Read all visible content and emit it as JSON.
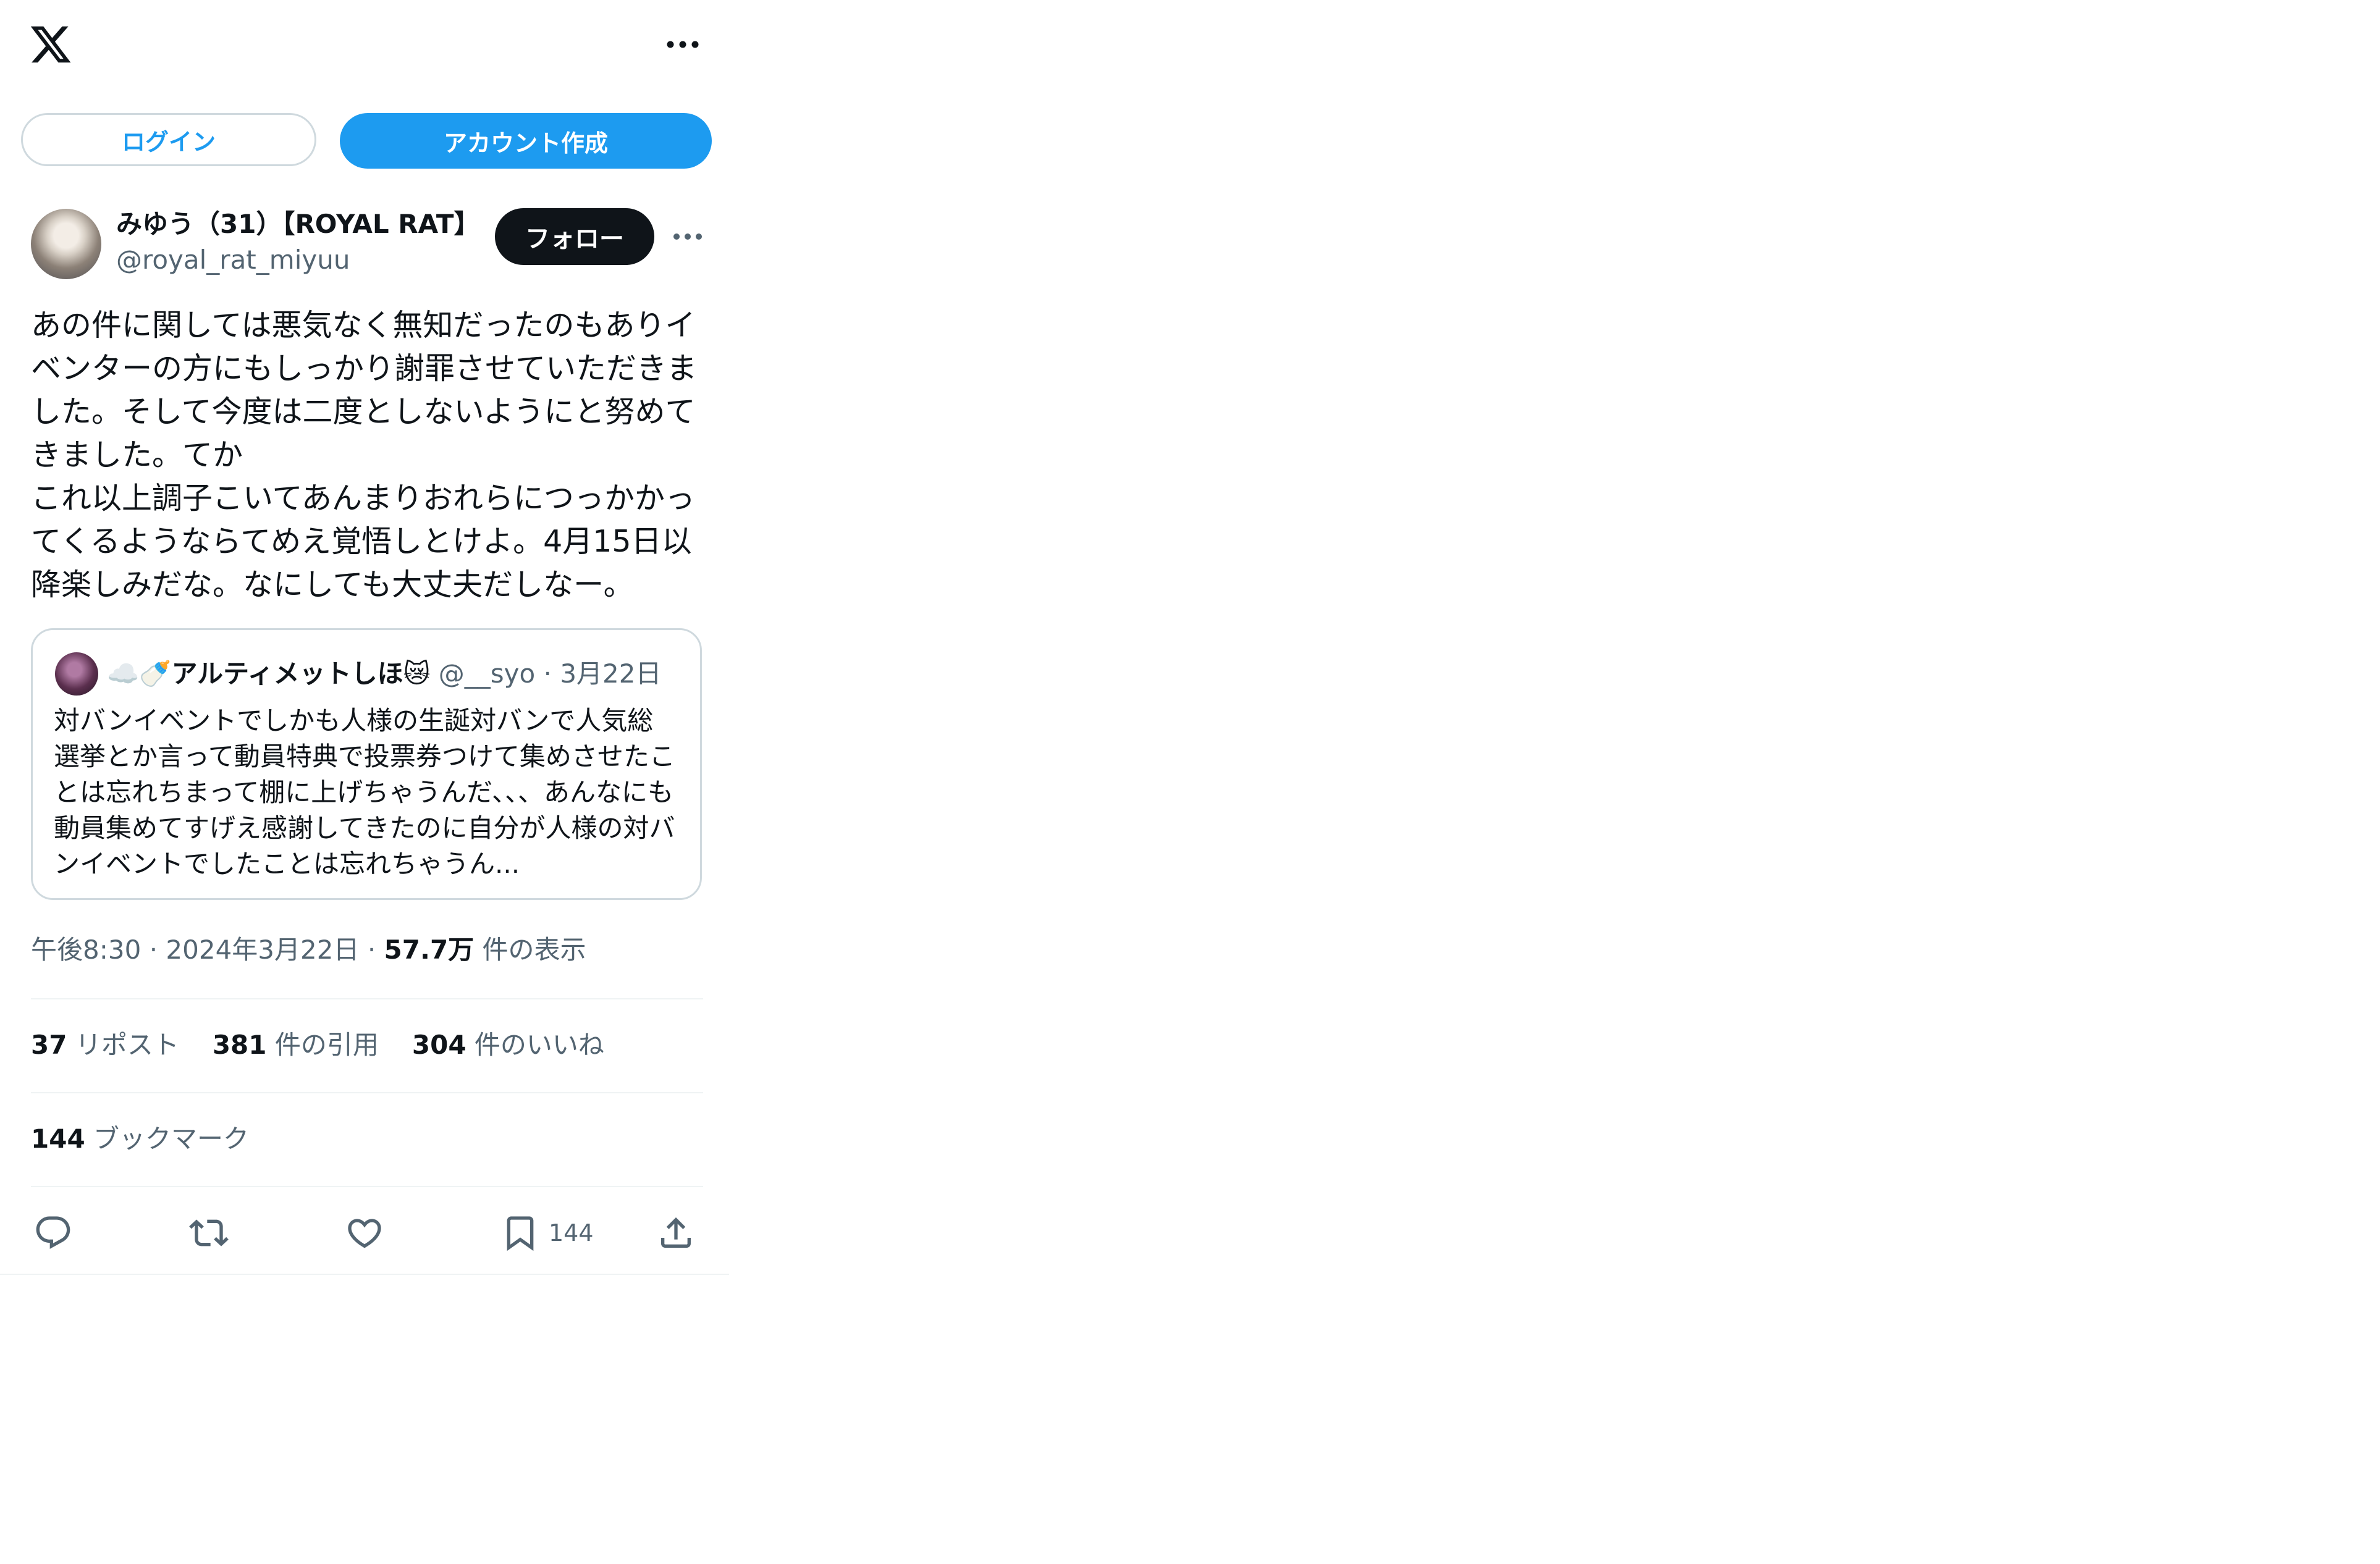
{
  "header": {
    "logo_icon": "x-logo-icon",
    "more_icon": "more-horizontal-icon"
  },
  "auth": {
    "login_label": "ログイン",
    "signup_label": "アカウント作成"
  },
  "author": {
    "display_name": "みゆう（31）【ROYAL RAT】(",
    "handle": "@royal_rat_miyuu",
    "follow_label": "フォロー"
  },
  "post": {
    "text": "あの件に関しては悪気なく無知だったのもありイベンターの方にもしっかり謝罪させていただきました。そして今度は二度としないようにと努めてきました。てか\nこれ以上調子こいてあんまりおれらにつっかかってくるようならてめえ覚悟しとけよ。4月15日以降楽しみだな。なにしても大丈夫だしなー。"
  },
  "quote": {
    "display_name": "☁️🍼アルティメットしほ😿",
    "handle": "@__syo",
    "separator": "·",
    "date": "3月22日",
    "text": "対バンイベントでしかも人様の生誕対バンで人気総選挙とか言って動員特典で投票券つけて集めさせたことは忘れちまって棚に上げちゃうんだ、、、あんなにも動員集めてすげえ感謝してきたのに自分が人様の対バンイベントでしたことは忘れちゃうん..."
  },
  "meta": {
    "time": "午後8:30",
    "date": "2024年3月22日",
    "sep": "·",
    "views_count": "57.7万",
    "views_label": "件の表示"
  },
  "stats": {
    "reposts_count": "37",
    "reposts_label": "リポスト",
    "quotes_count": "381",
    "quotes_label": "件の引用",
    "likes_count": "304",
    "likes_label": "件のいいね",
    "bookmarks_count": "144",
    "bookmarks_label": "ブックマーク"
  },
  "actions": {
    "reply_icon": "reply-icon",
    "repost_icon": "repost-icon",
    "like_icon": "heart-icon",
    "bookmark_icon": "bookmark-icon",
    "bookmark_count": "144",
    "share_icon": "share-icon"
  },
  "colors": {
    "accent": "#1d9bf0",
    "text": "#0f1419",
    "muted": "#536471",
    "border": "#cfd9de"
  }
}
